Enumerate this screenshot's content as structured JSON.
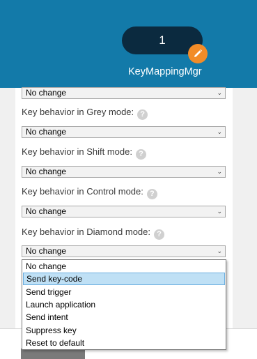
{
  "header": {
    "counter": "1",
    "app_name": "KeyMappingMgr",
    "edit_icon": "pencil-icon",
    "bg_color": "#137aa9",
    "badge_color": "#f28c28"
  },
  "fields": [
    {
      "label": "",
      "value": "No change"
    },
    {
      "label": "Key behavior in Grey mode:",
      "value": "No change"
    },
    {
      "label": "Key behavior in Shift mode:",
      "value": "No change"
    },
    {
      "label": "Key behavior in Control mode:",
      "value": "No change"
    },
    {
      "label": "Key behavior in Diamond mode:",
      "value": "No change"
    }
  ],
  "help_glyph": "?",
  "chevron_glyph": "⌄",
  "dropdown": {
    "options": [
      "No change",
      "Send key-code",
      "Send trigger",
      "Launch application",
      "Send intent",
      "Suppress key",
      "Reset to default"
    ],
    "highlighted": "Send key-code"
  }
}
